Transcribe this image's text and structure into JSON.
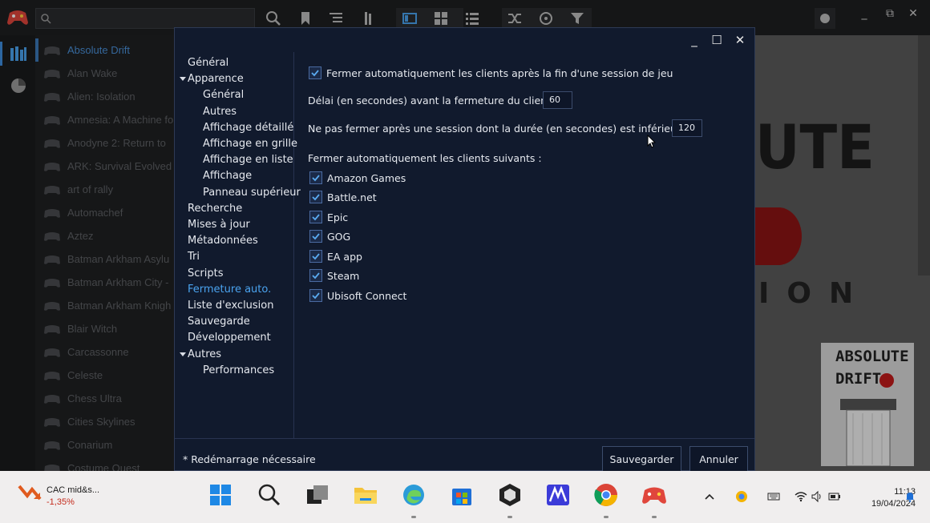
{
  "app": {
    "games": [
      "Absolute Drift",
      "Alan Wake",
      "Alien: Isolation",
      "Amnesia: A Machine fo",
      "Anodyne 2: Return to",
      "ARK: Survival Evolved",
      "art of rally",
      "Automachef",
      "Aztez",
      "Batman Arkham Asylu",
      "Batman Arkham City -",
      "Batman Arkham Knigh",
      "Blair Witch",
      "Carcassonne",
      "Celeste",
      "Chess Ultra",
      "Cities Skylines",
      "Conarium",
      "Costume Quest"
    ],
    "search_placeholder": "",
    "detail": {
      "big_text": "UTE",
      "sub_text": "ION",
      "cover_line1": "ABSOLUTE",
      "cover_line2": "DRIFT"
    }
  },
  "dialog": {
    "nav": [
      {
        "label": "Général"
      },
      {
        "label": "Apparence"
      },
      {
        "label": "Général"
      },
      {
        "label": "Autres"
      },
      {
        "label": "Affichage détaillé"
      },
      {
        "label": "Affichage en grille"
      },
      {
        "label": "Affichage en liste"
      },
      {
        "label": "Affichage"
      },
      {
        "label": "Panneau supérieur"
      },
      {
        "label": "Recherche"
      },
      {
        "label": "Mises à jour"
      },
      {
        "label": "Métadonnées"
      },
      {
        "label": "Tri"
      },
      {
        "label": "Scripts"
      },
      {
        "label": "Fermeture auto."
      },
      {
        "label": "Liste d'exclusion"
      },
      {
        "label": "Sauvegarde"
      },
      {
        "label": "Développement"
      },
      {
        "label": "Autres"
      },
      {
        "label": "Performances"
      }
    ],
    "selected_nav": "Fermeture auto.",
    "auto_close_label": "Fermer automatiquement les clients après la fin d'une session de jeu",
    "auto_close_checked": true,
    "delay_label": "Délai (en secondes) avant la fermeture du client :",
    "delay_value": "60",
    "min_session_label": "Ne pas fermer après une session dont la durée (en secondes) est inférieure à :",
    "min_session_value": "120",
    "clients_label": "Fermer automatiquement les clients suivants :",
    "clients": [
      {
        "label": "Amazon Games",
        "checked": true
      },
      {
        "label": "Battle.net",
        "checked": true
      },
      {
        "label": "Epic",
        "checked": true
      },
      {
        "label": "GOG",
        "checked": true
      },
      {
        "label": "EA app",
        "checked": true
      },
      {
        "label": "Steam",
        "checked": true
      },
      {
        "label": "Ubisoft Connect",
        "checked": true
      }
    ],
    "footer_note": "* Redémarrage nécessaire",
    "save_label": "Sauvegarder",
    "cancel_label": "Annuler",
    "min_label": "_",
    "max_label": "☐",
    "close_label": "✕"
  },
  "taskbar": {
    "stock_name": "CAC mid&s...",
    "stock_change": "-1,35%",
    "time": "11:13",
    "date": "19/04/2024"
  },
  "colors": {
    "accent": "#4aa3ef",
    "dialog_bg": "#111a2d",
    "stock_down": "#c42b1c"
  }
}
